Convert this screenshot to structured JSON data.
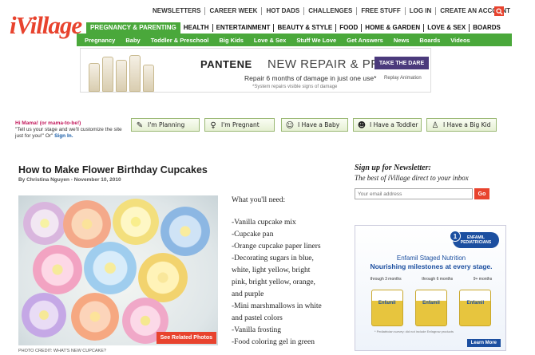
{
  "logo": "iVillage",
  "topnav": [
    "NEWSLETTERS",
    "CAREER WEEK",
    "HOT DADS",
    "CHALLENGES",
    "FREE STUFF",
    "LOG IN",
    "CREATE AN ACCOUNT"
  ],
  "mainnav": [
    "PREGNANCY & PARENTING",
    "HEALTH",
    "ENTERTAINMENT",
    "BEAUTY & STYLE",
    "FOOD",
    "HOME & GARDEN",
    "LOVE & SEX",
    "BOARDS"
  ],
  "subnav": [
    "Pregnancy",
    "Baby",
    "Toddler & Preschool",
    "Big Kids",
    "Love & Sex",
    "Stuff We Love",
    "Get Answers",
    "News",
    "Boards",
    "Videos"
  ],
  "ad": {
    "brand": "PANTENE",
    "headline": "NEW REPAIR & PROTECT",
    "sub": "Repair 6 months of damage in just one use*",
    "disclaimer": "*System repairs visible signs of damage",
    "cta": "TAKE THE DARE",
    "anim": "Replay Animation"
  },
  "stages": {
    "hi": "Hi Mama! (or mama-to-be!)",
    "prompt": "\"Tell us your stage and we'll customize the site just for you!\" Or\"",
    "signin": "Sign In.",
    "items": [
      "I'm Planning",
      "I'm Pregnant",
      "I Have a Baby",
      "I Have a Toddler",
      "I Have a Big Kid"
    ]
  },
  "article": {
    "title": "How to Make Flower Birthday Cupcakes",
    "byline": "By Christina Nguyen - November 10, 2010",
    "see_related": "See Related Photos",
    "credit": "PHOTO CREDIT: WHAT'S NEW CUPCAKE?",
    "needs_head": "What you'll need:",
    "needs": [
      "-Vanilla cupcake mix",
      "-Cupcake pan",
      "-Orange cupcake paper liners",
      "-Decorating sugars in blue,",
      "white, light yellow, bright",
      "pink, bright yellow, orange,",
      "and purple",
      "-Mini marshmallows in white",
      "and pastel colors",
      "-Vanilla frosting",
      "-Food coloring gel in green"
    ]
  },
  "newsletter": {
    "title": "Sign up for Newsletter:",
    "sub": "The best of iVillage direct to your inbox",
    "placeholder": "Your email address",
    "go": "Go"
  },
  "ad2": {
    "badge_num": "1",
    "badge": "ENFAMIL PEDIATRICIANS",
    "h1": "Enfamil Staged Nutrition",
    "h2": "Nourishing milestones at every stage.",
    "stages": [
      "through 3 months",
      "through 6 months",
      "9+ months"
    ],
    "cans": [
      "Enfamil",
      "Enfamil",
      "Enfamil"
    ],
    "fine": "* Pediatrician survey: did not include Enfagrow products",
    "learn": "Learn More"
  }
}
